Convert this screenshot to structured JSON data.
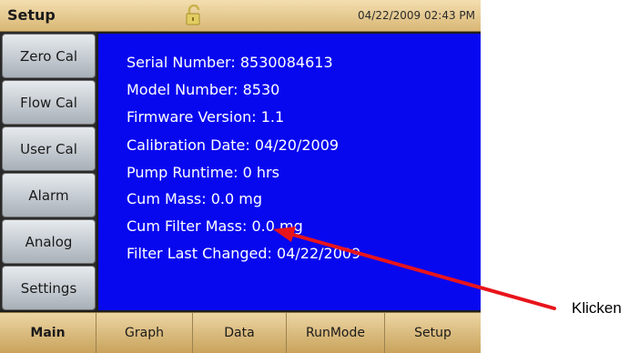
{
  "header": {
    "title": "Setup",
    "datetime": "04/22/2009 02:43 PM",
    "lock_icon": "padlock-open-icon"
  },
  "sidebar": {
    "items": [
      {
        "label": "Zero Cal"
      },
      {
        "label": "Flow Cal"
      },
      {
        "label": "User Cal"
      },
      {
        "label": "Alarm"
      },
      {
        "label": "Analog"
      },
      {
        "label": "Settings"
      }
    ]
  },
  "info": {
    "serial_number": "Serial Number:  8530084613",
    "model_number": "Model Number:  8530",
    "firmware_version": "Firmware Version:  1.1",
    "calibration_date": "Calibration Date:  04/20/2009",
    "pump_runtime": "Pump Runtime:  0 hrs",
    "cum_mass": "Cum Mass:  0.0 mg",
    "cum_filter_mass": "Cum Filter Mass:  0.0 mg",
    "filter_last_changed": "Filter Last Changed:  04/22/2009"
  },
  "tabs": [
    {
      "label": "Main"
    },
    {
      "label": "Graph"
    },
    {
      "label": "Data"
    },
    {
      "label": "RunMode"
    },
    {
      "label": "Setup"
    }
  ],
  "annotation": {
    "label": "Klicken",
    "arrow_color": "#e8141b"
  },
  "colors": {
    "panel_bg": "#0808ef",
    "bar_gold": "#d9b775"
  }
}
